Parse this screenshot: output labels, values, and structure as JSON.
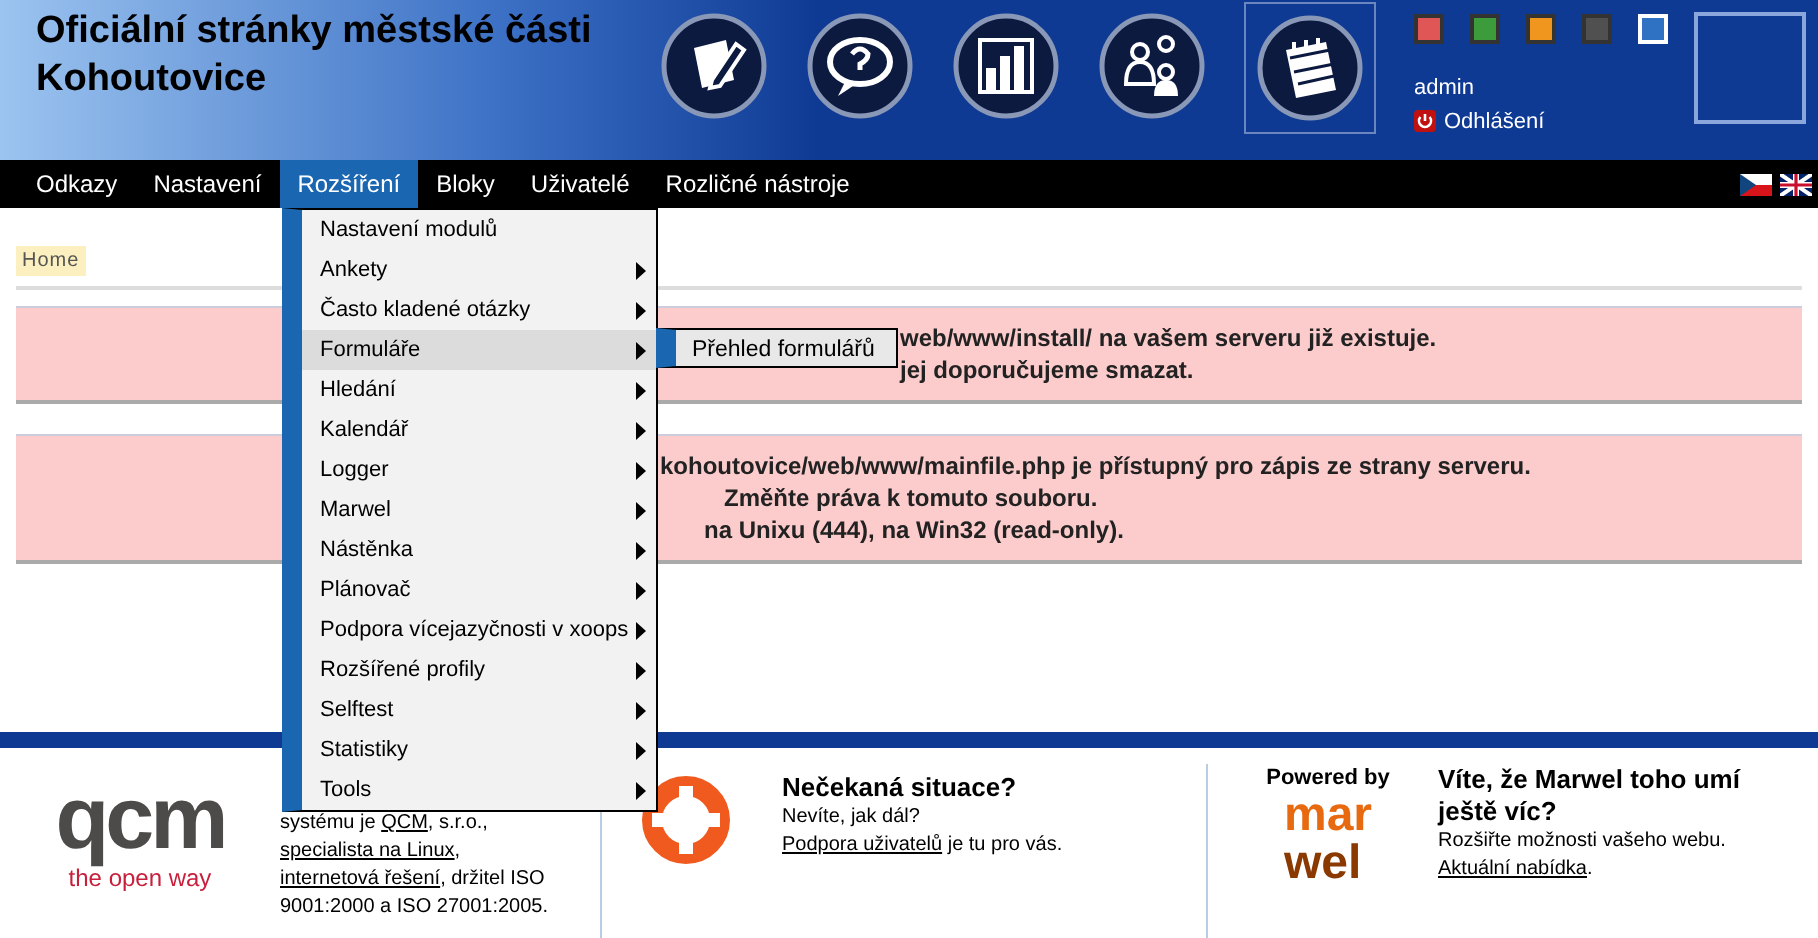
{
  "site_title": "Oficiální stránky městské části Kohoutovice",
  "themes": [
    {
      "color": "#e05656",
      "selected": false
    },
    {
      "color": "#3c9c3c",
      "selected": false
    },
    {
      "color": "#f0961e",
      "selected": false
    },
    {
      "color": "#505050",
      "selected": false
    },
    {
      "color": "#2f72c4",
      "selected": true
    }
  ],
  "user": "admin",
  "logout": "Odhlášení",
  "nav": [
    {
      "label": "Odkazy",
      "selected": false
    },
    {
      "label": "Nastavení",
      "selected": false
    },
    {
      "label": "Rozšíření",
      "selected": true
    },
    {
      "label": "Bloky",
      "selected": false
    },
    {
      "label": "Uživatelé",
      "selected": false
    },
    {
      "label": "Rozličné nástroje",
      "selected": false
    }
  ],
  "breadcrumb": "Home",
  "alerts": [
    {
      "lines": [
        "web/www/install/ na vašem serveru již existuje.",
        "jej doporučujeme smazat."
      ]
    },
    {
      "lines": [
        "kohoutovice/web/www/mainfile.php je přístupný pro zápis ze strany serveru.",
        "Změňte práva k tomuto souboru.",
        "na Unixu (444), na Win32 (read-only)."
      ]
    }
  ],
  "menu": [
    {
      "label": "Nastavení modulů",
      "submenu": false,
      "selected": false
    },
    {
      "label": "Ankety",
      "submenu": true,
      "selected": false
    },
    {
      "label": "Často kladené otázky",
      "submenu": true,
      "selected": false
    },
    {
      "label": "Formuláře",
      "submenu": true,
      "selected": true
    },
    {
      "label": "Hledání",
      "submenu": true,
      "selected": false
    },
    {
      "label": "Kalendář",
      "submenu": true,
      "selected": false
    },
    {
      "label": "Logger",
      "submenu": true,
      "selected": false
    },
    {
      "label": "Marwel",
      "submenu": true,
      "selected": false
    },
    {
      "label": "Nástěnka",
      "submenu": true,
      "selected": false
    },
    {
      "label": "Plánovač",
      "submenu": true,
      "selected": false
    },
    {
      "label": "Podpora vícejazyčnosti v xoops",
      "submenu": true,
      "selected": false
    },
    {
      "label": "Rozšířené profily",
      "submenu": true,
      "selected": false
    },
    {
      "label": "Selftest",
      "submenu": true,
      "selected": false
    },
    {
      "label": "Statistiky",
      "submenu": true,
      "selected": false
    },
    {
      "label": "Tools",
      "submenu": true,
      "selected": false
    }
  ],
  "submenu": [
    "Přehled formulářů"
  ],
  "footer": {
    "qcm_logo": "qcm",
    "qcm_tagline": "the open way",
    "about": [
      {
        "text": "systému je ",
        "link": false
      },
      {
        "text": "QCM",
        "link": true
      },
      {
        "text": ", s.r.o., ",
        "link": false
      },
      {
        "text": "specialista na Linux",
        "link": true
      },
      {
        "text": ", ",
        "link": false
      },
      {
        "text": "internetová řešení",
        "link": true
      },
      {
        "text": ", držitel ISO 9001:2000 a ISO 27001:2005.",
        "link": false
      }
    ],
    "help_title": "Nečekaná situace?",
    "help_text": "Nevíte, jak dál?",
    "help_link": "Podpora uživatelů",
    "help_after": " je tu pro vás.",
    "powered": "Powered by",
    "marwel_top": "mar",
    "marwel_bottom": "wel",
    "promo_title": "Víte, že Marwel toho umí ještě víc?",
    "promo_text": "Rozšiřte možnosti vašeho webu.",
    "promo_link": "Aktuální nabídka",
    "promo_after": "."
  }
}
